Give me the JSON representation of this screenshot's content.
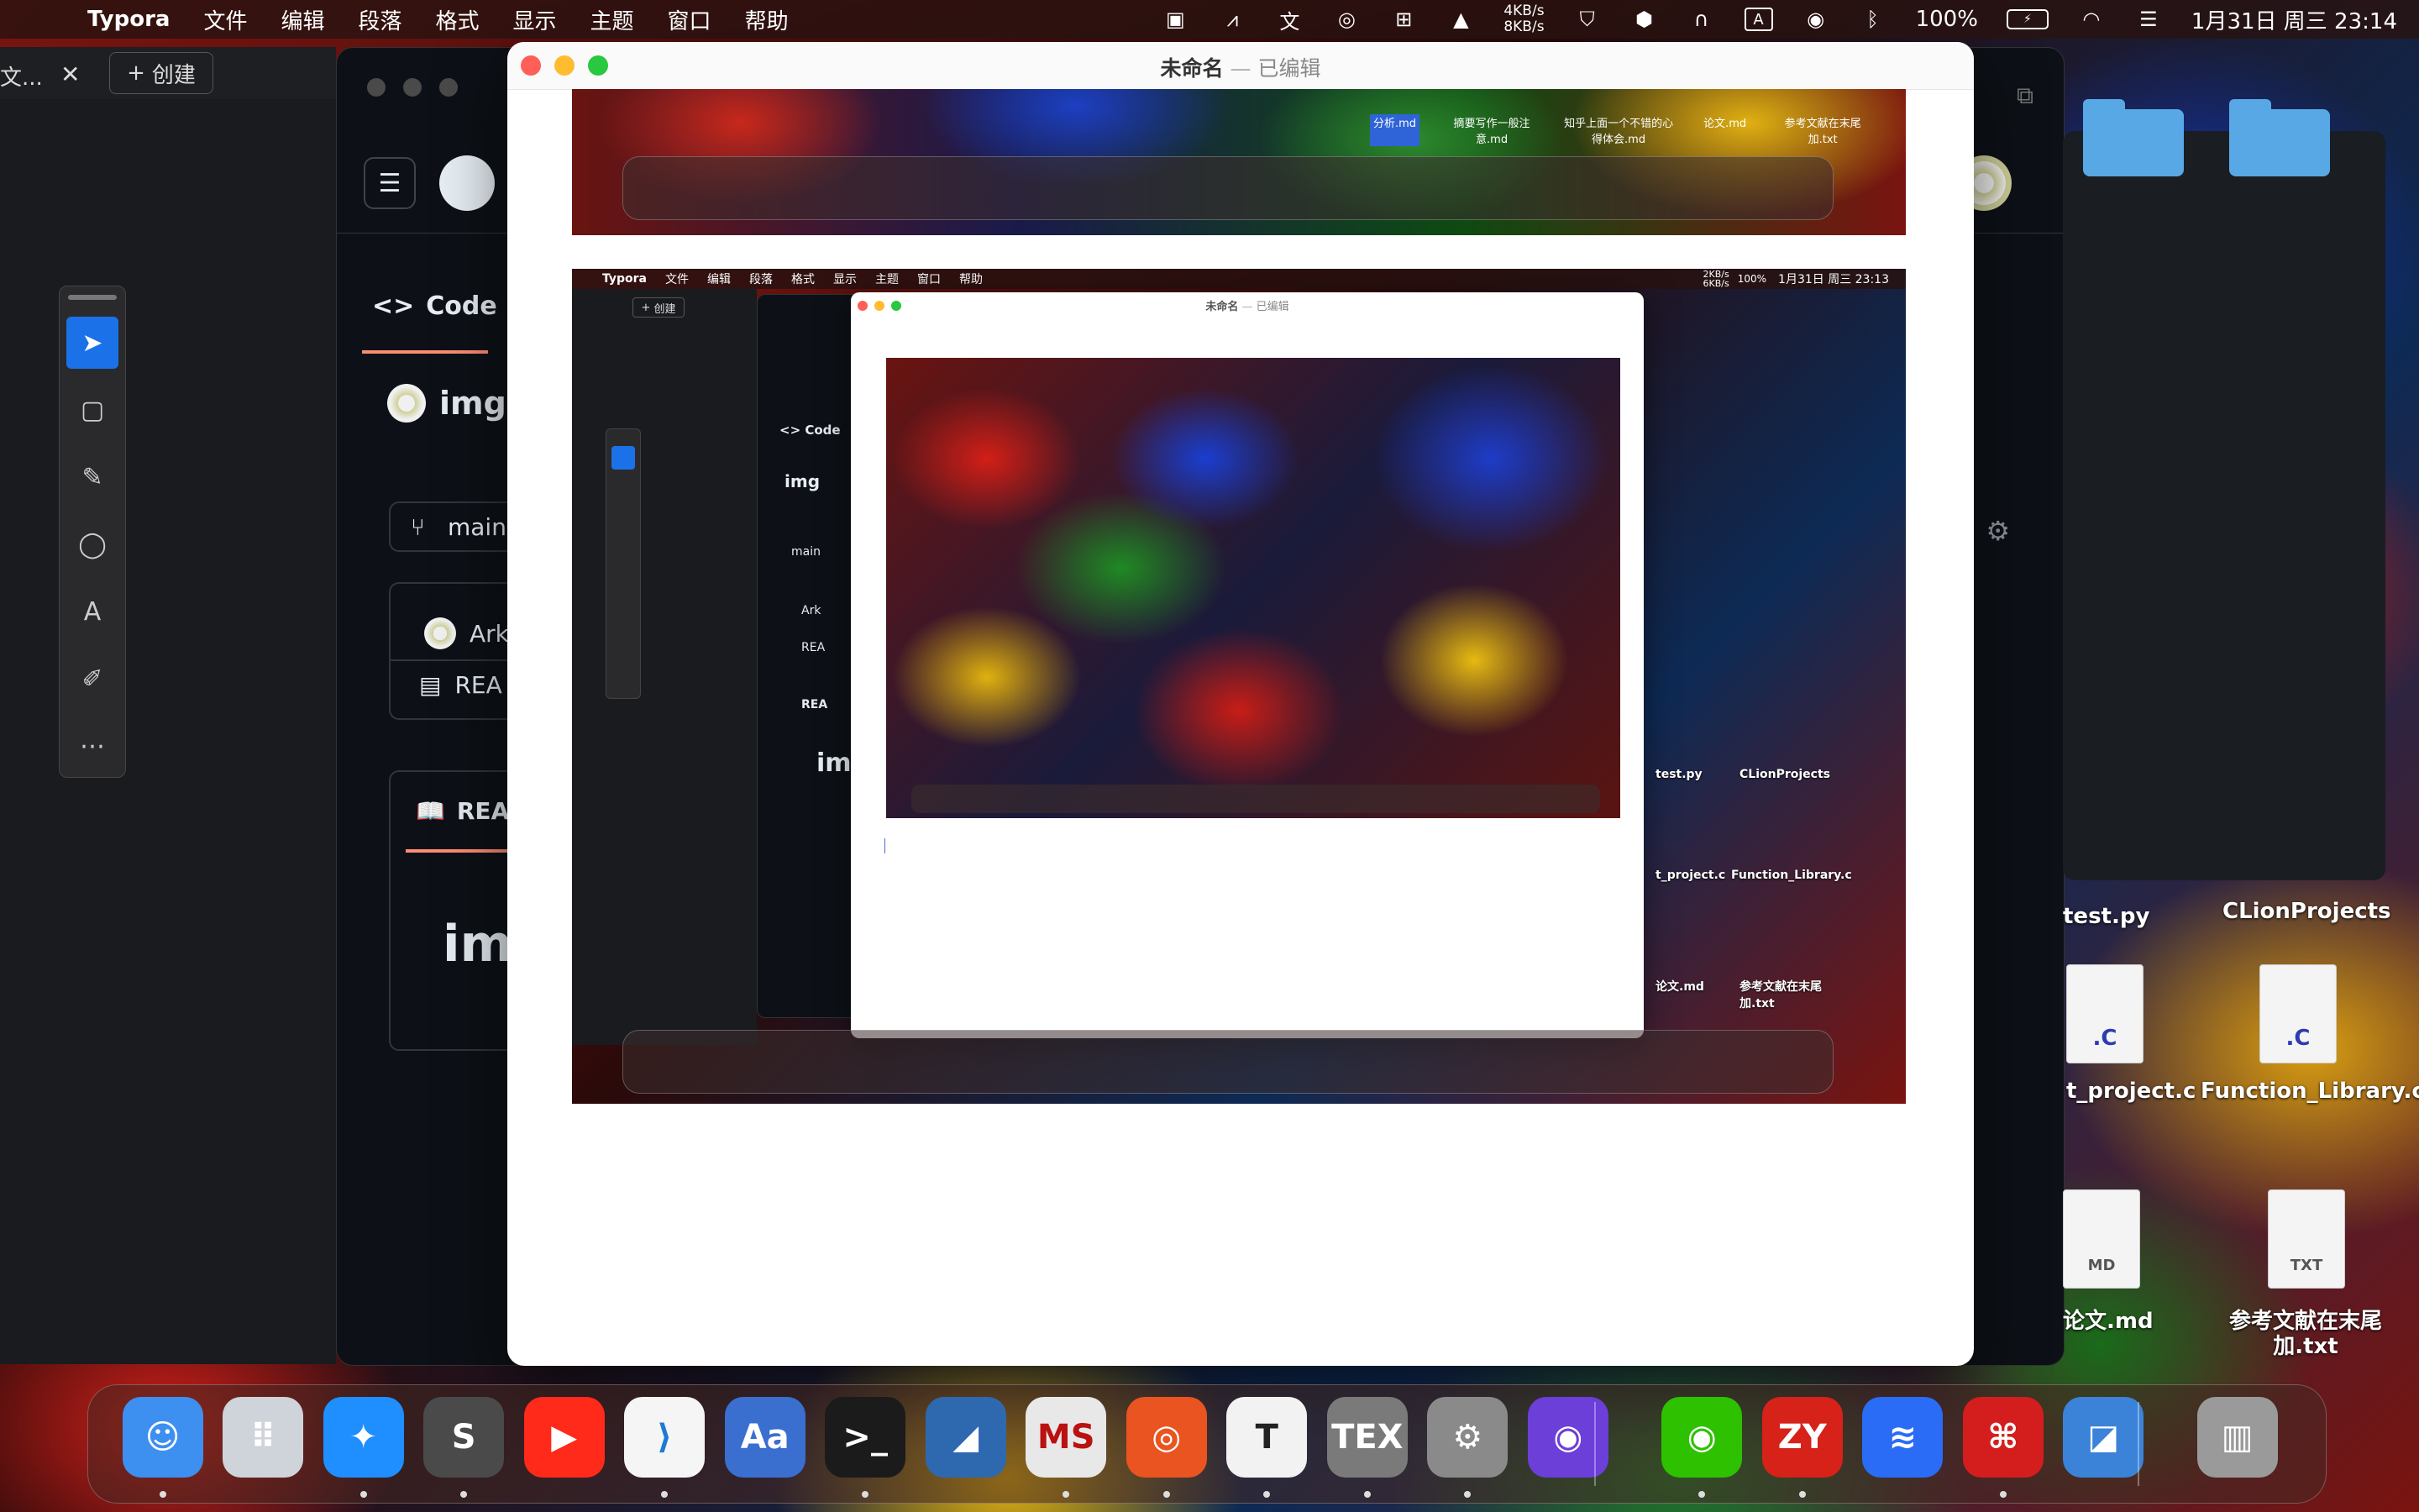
{
  "menubar": {
    "app_name": "Typora",
    "menus": [
      "文件",
      "编辑",
      "段落",
      "格式",
      "显示",
      "主题",
      "窗口",
      "帮助"
    ],
    "net_up": "4KB/s",
    "net_down": "8KB/s",
    "battery": "100%",
    "clock": "1月31日 周三  23:14",
    "status_icons": [
      "image-icon",
      "arrows-icon",
      "translate-icon",
      "wechat-icon",
      "input-method-icon",
      "cat-icon",
      "shield-icon",
      "hex-icon",
      "headphones-icon",
      "letter-a-icon",
      "user-icon",
      "bluetooth-icon",
      "battery-icon",
      "wifi-icon",
      "control-center-icon"
    ]
  },
  "browser_tab": {
    "title": "文...",
    "close": "✕",
    "new_tab": "创建"
  },
  "github": {
    "code_tab": "Code",
    "repo_name": "img",
    "branch": "main",
    "commit_author": "Ark",
    "readme_file": "REA",
    "readme_tab": "REA",
    "readme_heading": "img"
  },
  "typora": {
    "title": "未命名",
    "separator": "—",
    "status": "已编辑"
  },
  "nested_screenshot": {
    "menubar_app": "Typora",
    "menus": [
      "文件",
      "编辑",
      "段落",
      "格式",
      "显示",
      "主题",
      "窗口",
      "帮助"
    ],
    "clock": "1月31日 周三  23:13",
    "net_up": "2KB/s",
    "net_down": "6KB/s",
    "battery": "100%",
    "tab_new": "创建",
    "window_title": "未命名",
    "window_separator": "—",
    "window_status": "已编辑",
    "code_tab": "Code",
    "repo_name": "img",
    "branch": "main",
    "author": "Ark",
    "readme": "REA",
    "readme_tab": "REA",
    "heading": "img",
    "desktop_labels": [
      "test.py",
      "CLionProjects",
      "t_project.c",
      "Function_Library.c",
      "论文.md",
      "参考文献在末尾加.txt"
    ]
  },
  "top_strip_labels": [
    "分析.md",
    "摘要写作一般注意.md",
    "知乎上面一个不错的心得体会.md",
    "论文.md",
    "参考文献在末尾加.txt"
  ],
  "desktop": {
    "items": [
      {
        "label": "test.py"
      },
      {
        "label": "CLionProjects"
      },
      {
        "label": "t_project.c"
      },
      {
        "label": "Function_Library.c"
      },
      {
        "label": "论文.md"
      },
      {
        "label": "参考文献在末尾加.txt"
      }
    ]
  },
  "dock": {
    "apps": [
      {
        "name": "Finder",
        "icon": "finder-icon",
        "color": "#3d8ff0"
      },
      {
        "name": "Launchpad",
        "icon": "launchpad-icon",
        "color": "#cfd3da"
      },
      {
        "name": "Safari",
        "icon": "safari-icon",
        "color": "#1f8fff"
      },
      {
        "name": "Sublime Text",
        "icon": "sublime-icon",
        "color": "#4a4a4a"
      },
      {
        "name": "YouTube",
        "icon": "youtube-icon",
        "color": "#ff2a1a"
      },
      {
        "name": "VS Code",
        "icon": "vscode-icon",
        "color": "#f5f5f5"
      },
      {
        "name": "Dictionary",
        "icon": "dictionary-icon",
        "color": "#3a6fd0"
      },
      {
        "name": "Terminal",
        "icon": "terminal-icon",
        "color": "#1b1b1b"
      },
      {
        "name": "MATLAB",
        "icon": "matlab-icon",
        "color": "#2e69b0"
      },
      {
        "name": "MathType",
        "icon": "mathtype-icon",
        "color": "#e8e8e8"
      },
      {
        "name": "Ubuntu",
        "icon": "ubuntu-icon",
        "color": "#e95420"
      },
      {
        "name": "Typora",
        "icon": "typora-icon",
        "color": "#f2f2f2"
      },
      {
        "name": "TeX",
        "icon": "tex-icon",
        "color": "#7a7a7a"
      },
      {
        "name": "System Settings",
        "icon": "settings-icon",
        "color": "#8a8a8a"
      },
      {
        "name": "Chatbot",
        "icon": "chatbot-icon",
        "color": "#6b3fd8"
      },
      {
        "name": "WeChat",
        "icon": "wechat-icon",
        "color": "#2dc100"
      },
      {
        "name": "ZY",
        "icon": "zy-icon",
        "color": "#d62218"
      },
      {
        "name": "Lark",
        "icon": "lark-icon",
        "color": "#2a6cf5"
      },
      {
        "name": "Acrobat",
        "icon": "acrobat-icon",
        "color": "#d41e1e"
      },
      {
        "name": "Preview",
        "icon": "preview-icon",
        "color": "#3b83d8"
      },
      {
        "name": "Trash",
        "icon": "trash-icon",
        "color": "#9a9a9a"
      }
    ],
    "zy_label": "ZY",
    "tex_label": "TEX",
    "typora_label": "T",
    "mathtype_label": "MS"
  }
}
